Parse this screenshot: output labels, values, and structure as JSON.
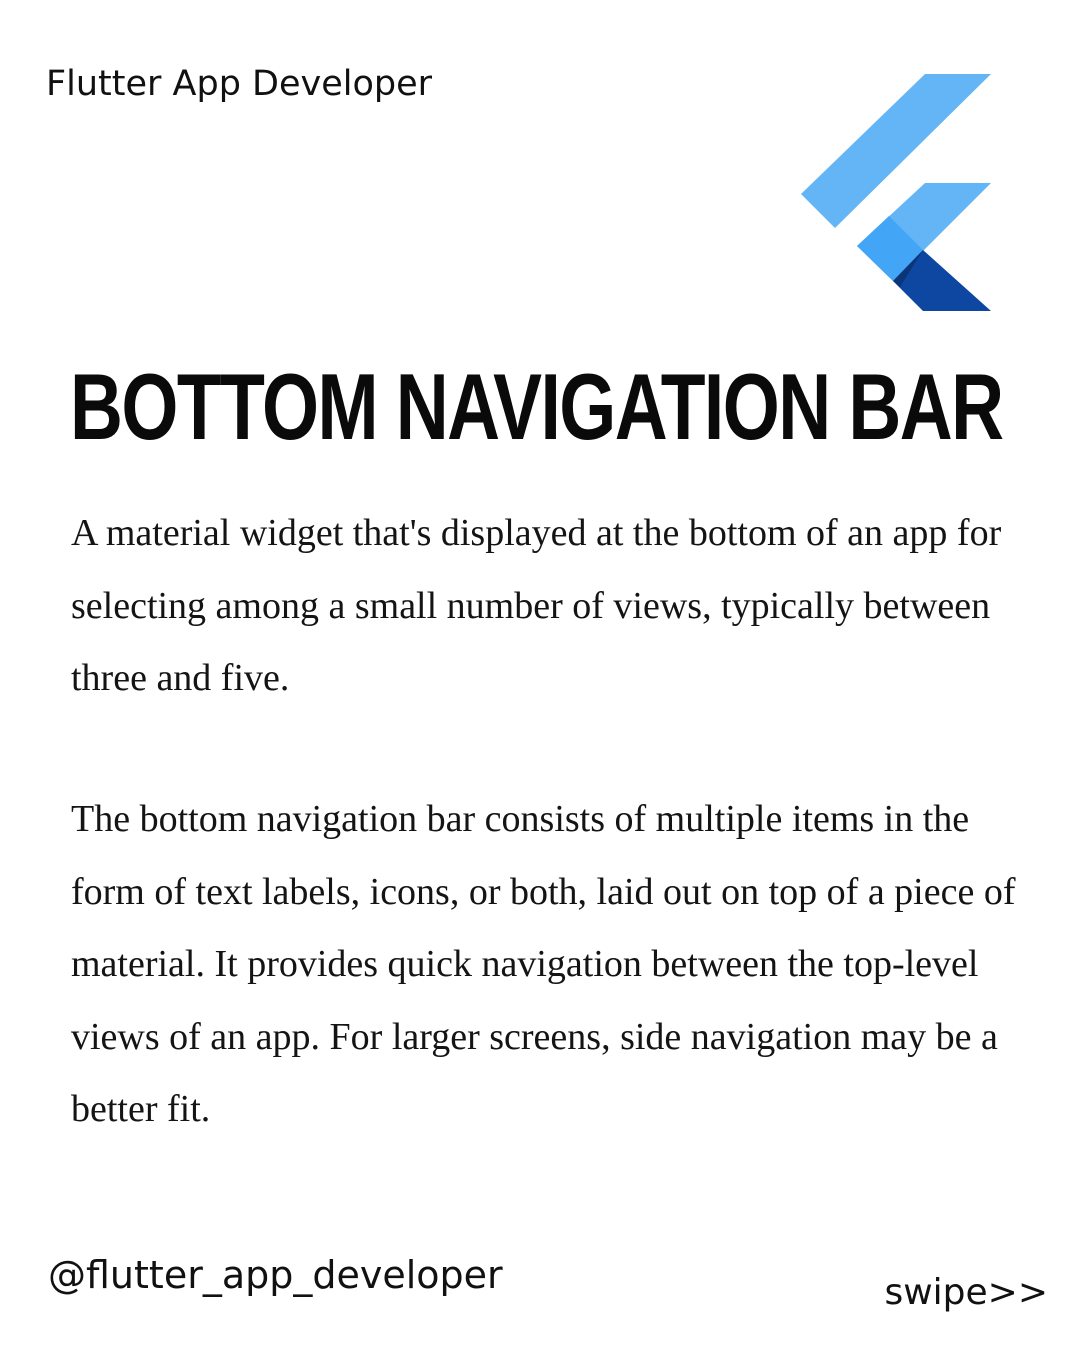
{
  "header": {
    "brand_name": "Flutter App Developer",
    "logo_icon": "flutter-logo-icon",
    "logo_colors": {
      "light": "#64B5F6",
      "mid": "#42A5F5",
      "dark": "#0D47A1"
    }
  },
  "main": {
    "title": "BOTTOM NAVIGATION BAR",
    "paragraphs": [
      "A material widget that's displayed at the bottom of an app for selecting among a small number of views, typically between three and five.",
      "The bottom navigation bar consists of multiple items in the form of text labels, icons, or both, laid out on top of a piece of material. It provides quick navigation between the top-level views of an app. For larger screens, side navigation may be a better fit."
    ]
  },
  "footer": {
    "handle": "@flutter_app_developer",
    "swipe_label": "swipe>>"
  }
}
